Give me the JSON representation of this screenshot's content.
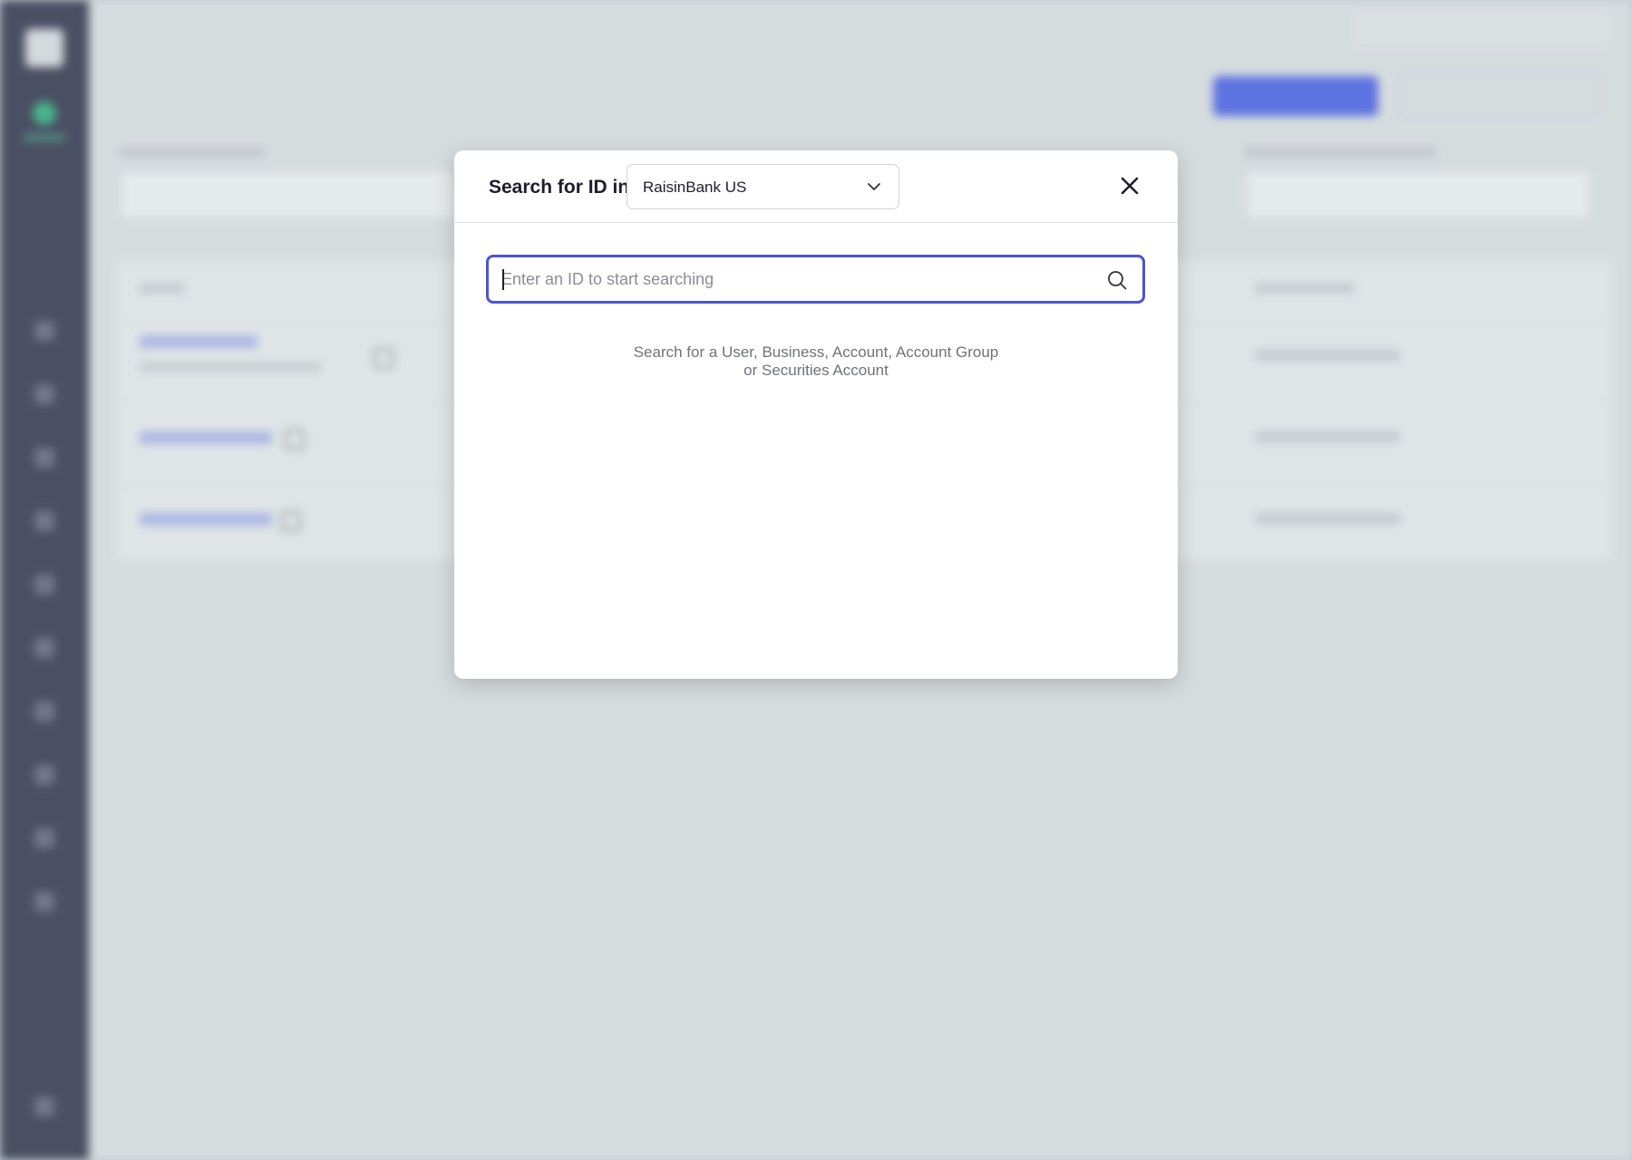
{
  "modal": {
    "title": "Search for ID in",
    "bank_select": {
      "selected": "RaisinBank US"
    },
    "search": {
      "placeholder": "Enter an ID to start searching",
      "value": ""
    },
    "hint_line1": "Search for a User, Business, Account, Account Group",
    "hint_line2": "or Securities Account",
    "icons": {
      "close": "close-icon",
      "search": "search-icon",
      "dropdown": "chevron-down-icon"
    }
  },
  "colors": {
    "accent": "#4b55d3",
    "sidebar": "#22223d",
    "environment_dot": "#1fb577",
    "primary_button": "#3e55f0"
  }
}
